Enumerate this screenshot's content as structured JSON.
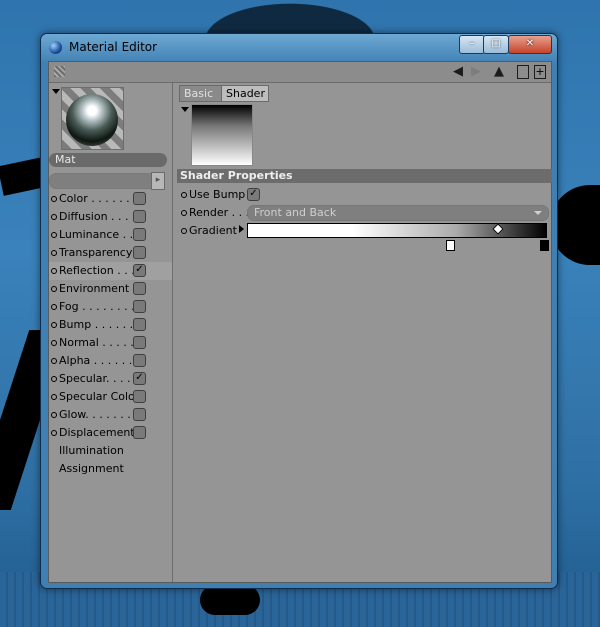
{
  "window": {
    "title": "Material Editor"
  },
  "titlebar_buttons": {
    "minimize": "–",
    "maximize": "□",
    "close": "✕"
  },
  "toolbar": {
    "icons": [
      "grip-icon",
      "arrow-left-icon",
      "arrow-right-icon",
      "arrow-up-icon",
      "lock-icon",
      "new-window-icon"
    ]
  },
  "material": {
    "name": "Mat"
  },
  "channels": [
    {
      "label": "Color . . . . . . . .",
      "checked": false,
      "active": false
    },
    {
      "label": "Diffusion . . . . .",
      "checked": false,
      "active": false
    },
    {
      "label": "Luminance . . . .",
      "checked": false,
      "active": false
    },
    {
      "label": "Transparency",
      "checked": false,
      "active": false
    },
    {
      "label": "Reflection . . . .",
      "checked": true,
      "active": true
    },
    {
      "label": "Environment",
      "checked": false,
      "active": false
    },
    {
      "label": "Fog . . . . . . . . .",
      "checked": false,
      "active": false
    },
    {
      "label": "Bump . . . . . . .",
      "checked": false,
      "active": false
    },
    {
      "label": "Normal . . . . . .",
      "checked": false,
      "active": false
    },
    {
      "label": "Alpha . . . . . . .",
      "checked": false,
      "active": false
    },
    {
      "label": "Specular. . . . .",
      "checked": true,
      "active": false
    },
    {
      "label": "Specular Color",
      "checked": false,
      "active": false
    },
    {
      "label": "Glow. . . . . . . .",
      "checked": false,
      "active": false
    },
    {
      "label": "Displacement",
      "checked": false,
      "active": false
    }
  ],
  "extra_items": [
    "Illumination",
    "Assignment"
  ],
  "tabs": {
    "basic": "Basic",
    "shader": "Shader"
  },
  "shader": {
    "section_title": "Shader Properties",
    "use_bump_label": "Use Bump",
    "use_bump_checked": true,
    "render_label": "Render . . .",
    "render_value": "Front and Back",
    "gradient_label": "Gradient"
  },
  "colors": {
    "panel": "#959595",
    "section": "#6c6c6c",
    "window_frame": "#3f7fb2"
  }
}
